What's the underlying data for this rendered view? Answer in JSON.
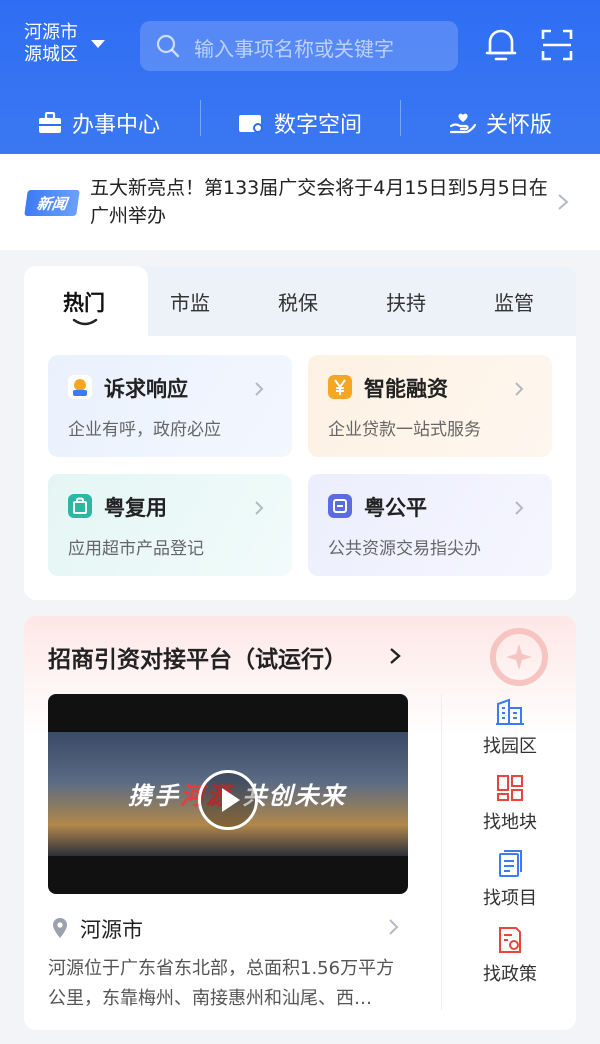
{
  "header": {
    "city_line1": "河源市",
    "city_line2": "源城区",
    "search_placeholder": "输入事项名称或关键字"
  },
  "top_tabs": [
    {
      "label": "办事中心"
    },
    {
      "label": "数字空间"
    },
    {
      "label": "关怀版"
    }
  ],
  "news": {
    "tag": "新闻",
    "text": "五大新亮点！第133届广交会将于4月15日到5月5日在广州举办"
  },
  "hot": {
    "tabs": [
      {
        "label": "热门"
      },
      {
        "label": "市监"
      },
      {
        "label": "税保"
      },
      {
        "label": "扶持"
      },
      {
        "label": "监管"
      }
    ],
    "services": [
      {
        "title": "诉求响应",
        "subtitle": "企业有呼，政府必应"
      },
      {
        "title": "智能融资",
        "subtitle": "企业贷款一站式服务"
      },
      {
        "title": "粤复用",
        "subtitle": "应用超市产品登记"
      },
      {
        "title": "粤公平",
        "subtitle": "公共资源交易指尖办"
      }
    ]
  },
  "invest": {
    "title": "招商引资对接平台（试运行）",
    "video_caption": "携手河源 共创未来",
    "video_caption_a": "携手",
    "video_caption_b": "河源",
    "video_caption_c": "共创未来",
    "location_name": "河源市",
    "location_desc": "河源位于广东省东北部，总面积1.56万平方公里，东靠梅州、南接惠州和汕尾、西…",
    "quick_links": [
      {
        "label": "找园区"
      },
      {
        "label": "找地块"
      },
      {
        "label": "找项目"
      },
      {
        "label": "找政策"
      }
    ]
  },
  "colors": {
    "brand_blue": "#2f6df4",
    "accent_red": "#e8453c"
  }
}
